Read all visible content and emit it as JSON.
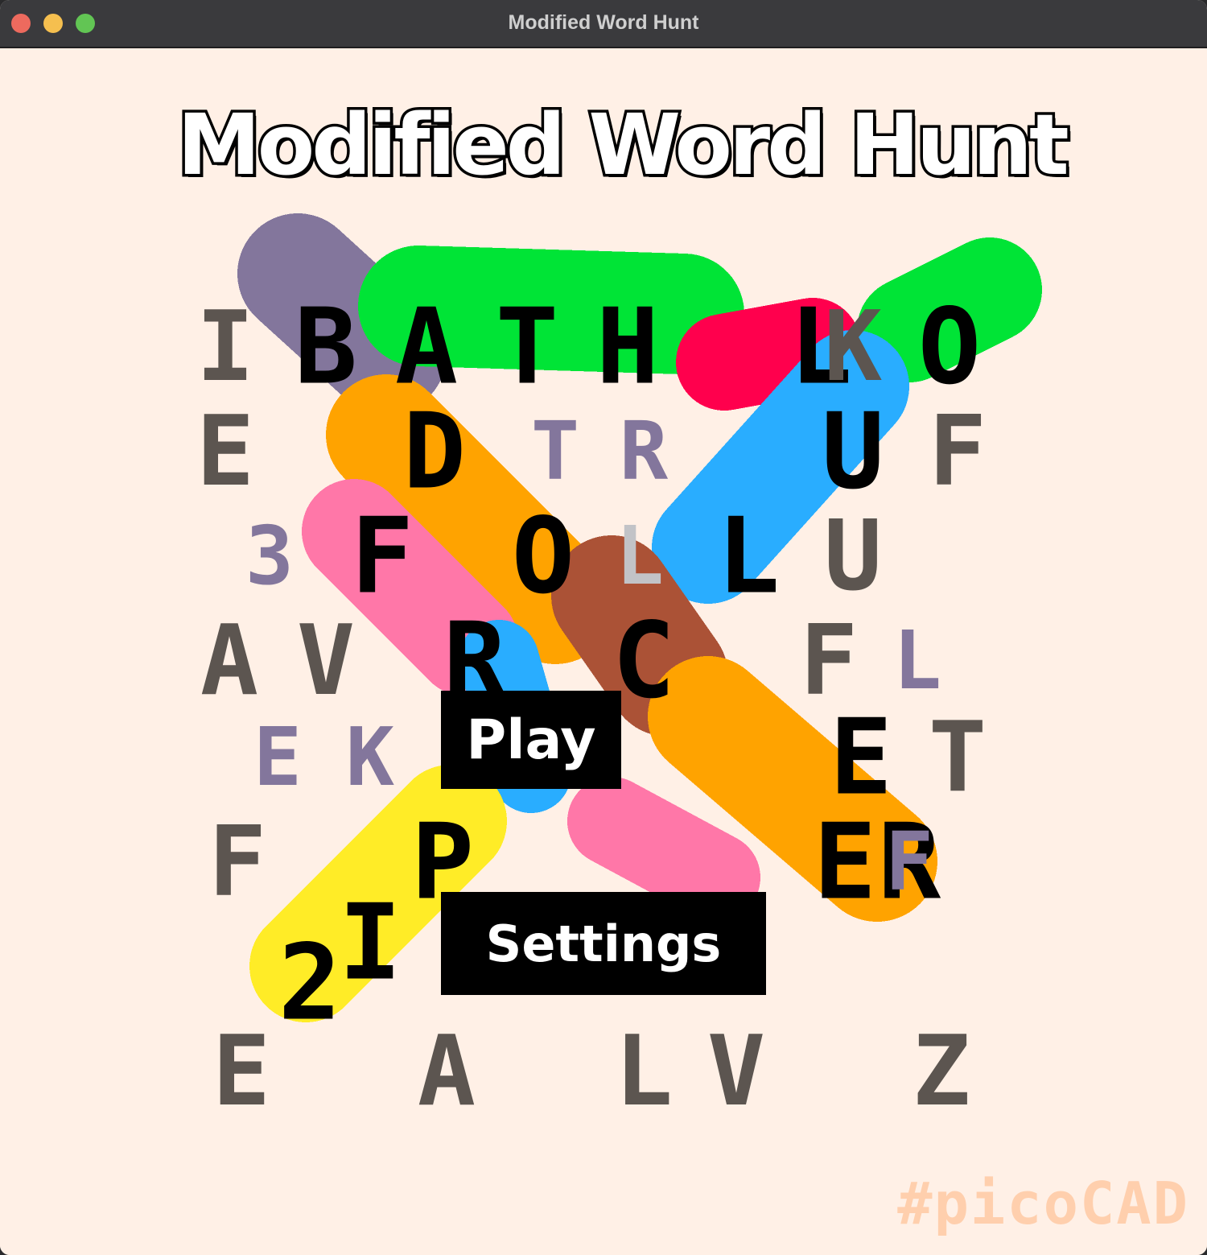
{
  "window": {
    "title": "Modified Word Hunt",
    "traffic_lights": [
      "close",
      "minimize",
      "zoom"
    ]
  },
  "game": {
    "title": "Modified Word Hunt",
    "play_label": "Play",
    "settings_label": "Settings",
    "watermark": "#picoCAD"
  },
  "colors": {
    "background": "#fff0e6",
    "title_fill": "#ffffff",
    "title_outline": "#000000",
    "button_bg": "#000000",
    "button_text": "#ffffff",
    "letter_dark": "#5c5550",
    "letter_mid": "#83769c",
    "letter_light": "#c2c3c7",
    "letter_found": "#000000",
    "highlight_purple": "#83769c",
    "highlight_green": "#00e436",
    "highlight_red": "#ff004d",
    "highlight_blue": "#29adff",
    "highlight_orange": "#ffa300",
    "highlight_pink": "#ff77a8",
    "highlight_brown": "#ab5236",
    "highlight_yellow": "#ffec27",
    "watermark": "#ffcfad"
  },
  "letters": [
    {
      "ch": "I",
      "row": 0,
      "col": 0,
      "tone": "dark"
    },
    {
      "ch": "B",
      "row": 0,
      "col": 1,
      "tone": "found"
    },
    {
      "ch": "A",
      "row": 0,
      "col": 2,
      "tone": "found"
    },
    {
      "ch": "T",
      "row": 0,
      "col": 3,
      "tone": "found"
    },
    {
      "ch": "H",
      "row": 0,
      "col": 4,
      "tone": "found"
    },
    {
      "ch": "L",
      "row": 0,
      "col": 5,
      "tone": "found"
    },
    {
      "ch": "K",
      "row": 0,
      "col": 6,
      "tone": "dark"
    },
    {
      "ch": "O",
      "row": 0,
      "col": 7,
      "tone": "found"
    },
    {
      "ch": "E",
      "row": 1,
      "col": 0,
      "tone": "dark"
    },
    {
      "ch": "D",
      "row": 1,
      "col": 1,
      "tone": "found"
    },
    {
      "ch": "T",
      "row": 1,
      "col": 2,
      "tone": "mid"
    },
    {
      "ch": "R",
      "row": 1,
      "col": 3,
      "tone": "mid"
    },
    {
      "ch": "U",
      "row": 1,
      "col": 4,
      "tone": "found"
    },
    {
      "ch": "F",
      "row": 1,
      "col": 5,
      "tone": "dark"
    },
    {
      "ch": "3",
      "row": 2,
      "col": 0,
      "tone": "mid"
    },
    {
      "ch": "F",
      "row": 2,
      "col": 1,
      "tone": "found"
    },
    {
      "ch": "O",
      "row": 2,
      "col": 2,
      "tone": "found"
    },
    {
      "ch": "L",
      "row": 2,
      "col": 3,
      "tone": "light"
    },
    {
      "ch": "L",
      "row": 2,
      "col": 4,
      "tone": "found"
    },
    {
      "ch": "U",
      "row": 2,
      "col": 5,
      "tone": "dark"
    },
    {
      "ch": "A",
      "row": 3,
      "col": 0,
      "tone": "dark"
    },
    {
      "ch": "V",
      "row": 3,
      "col": 1,
      "tone": "dark"
    },
    {
      "ch": "R",
      "row": 3,
      "col": 2,
      "tone": "found"
    },
    {
      "ch": "C",
      "row": 3,
      "col": 3,
      "tone": "found"
    },
    {
      "ch": "F",
      "row": 3,
      "col": 4,
      "tone": "dark"
    },
    {
      "ch": "L",
      "row": 3,
      "col": 5,
      "tone": "mid"
    },
    {
      "ch": "E",
      "row": 4,
      "col": 0,
      "tone": "mid"
    },
    {
      "ch": "K",
      "row": 4,
      "col": 1,
      "tone": "mid"
    },
    {
      "ch": "E",
      "row": 4,
      "col": 4,
      "tone": "found"
    },
    {
      "ch": "T",
      "row": 4,
      "col": 5,
      "tone": "dark"
    },
    {
      "ch": "F",
      "row": 5,
      "col": 0,
      "tone": "dark"
    },
    {
      "ch": "P",
      "row": 5,
      "col": 1,
      "tone": "found"
    },
    {
      "ch": "E",
      "row": 5,
      "col": 3,
      "tone": "found"
    },
    {
      "ch": "R",
      "row": 5,
      "col": 4,
      "tone": "found"
    },
    {
      "ch": "F",
      "row": 5,
      "col": 5,
      "tone": "mid"
    },
    {
      "ch": "I",
      "row": 6,
      "col": 0,
      "tone": "found"
    },
    {
      "ch": "2",
      "row": 6,
      "col": 0,
      "tone": "found"
    },
    {
      "ch": "E",
      "row": 7,
      "col": 0,
      "tone": "dark"
    },
    {
      "ch": "A",
      "row": 7,
      "col": 1,
      "tone": "dark"
    },
    {
      "ch": "L",
      "row": 7,
      "col": 2,
      "tone": "dark"
    },
    {
      "ch": "V",
      "row": 7,
      "col": 3,
      "tone": "dark"
    },
    {
      "ch": "Z",
      "row": 7,
      "col": 4,
      "tone": "dark"
    }
  ]
}
